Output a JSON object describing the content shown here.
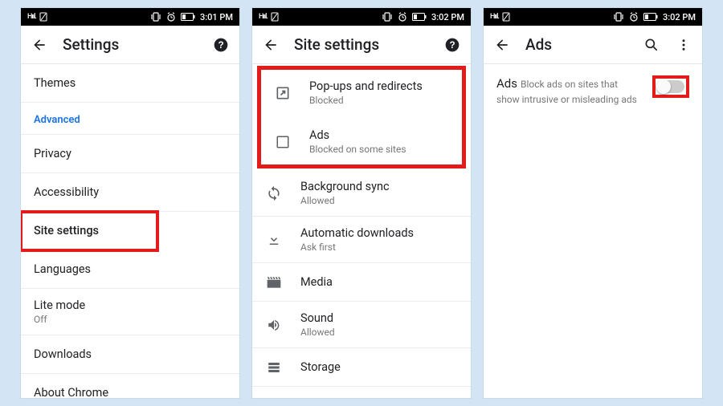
{
  "statusbar": {
    "network": "H",
    "time1": "3:01 PM",
    "time2": "3:02 PM",
    "time3": "3:02 PM"
  },
  "screen1": {
    "title": "Settings",
    "items": {
      "themes": "Themes",
      "advanced": "Advanced",
      "privacy": "Privacy",
      "accessibility": "Accessibility",
      "site_settings": "Site settings",
      "languages": "Languages",
      "lite_mode": "Lite mode",
      "lite_mode_sub": "Off",
      "downloads": "Downloads",
      "about": "About Chrome"
    }
  },
  "screen2": {
    "title": "Site settings",
    "items": {
      "popups": "Pop-ups and redirects",
      "popups_sub": "Blocked",
      "ads": "Ads",
      "ads_sub": "Blocked on some sites",
      "bg_sync": "Background sync",
      "bg_sync_sub": "Allowed",
      "auto_dl": "Automatic downloads",
      "auto_dl_sub": "Ask first",
      "media": "Media",
      "sound": "Sound",
      "sound_sub": "Allowed",
      "storage": "Storage"
    }
  },
  "screen3": {
    "title": "Ads",
    "ads_label": "Ads",
    "ads_desc": "Block ads on sites that show intrusive or misleading ads"
  }
}
